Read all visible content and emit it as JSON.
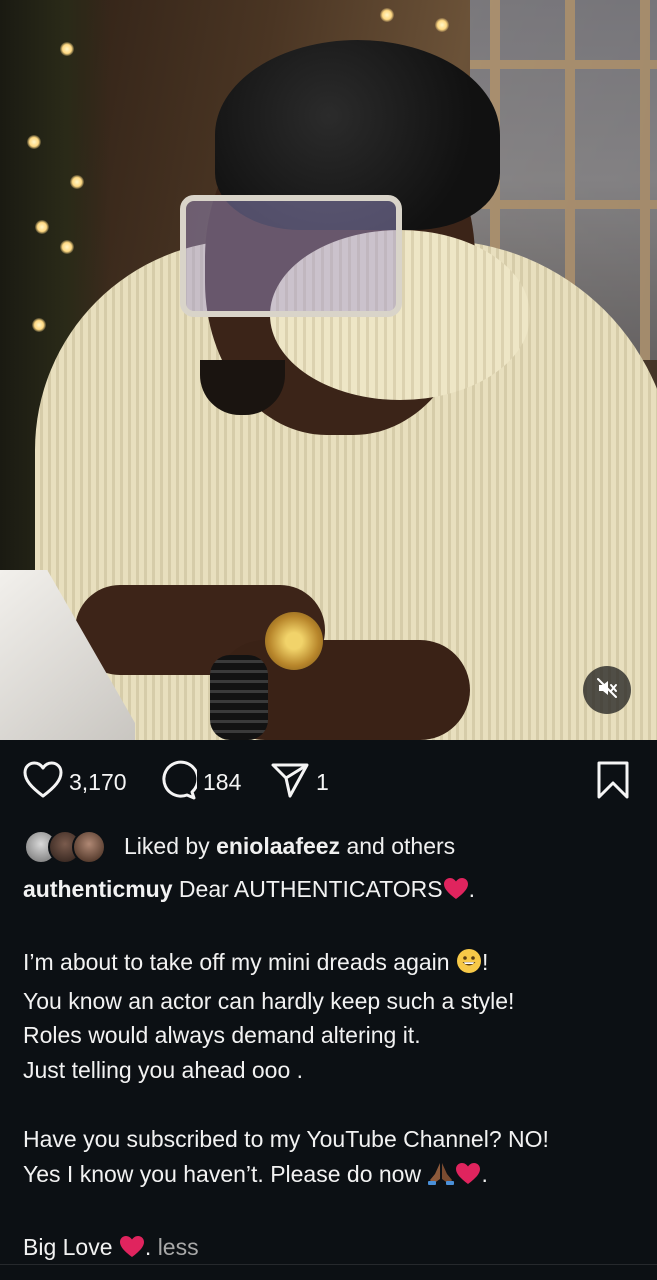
{
  "post": {
    "media": {
      "type": "video",
      "mute_icon": "speaker-muted-icon"
    },
    "actions": {
      "like_icon": "heart-icon",
      "like_count": "3,170",
      "comment_icon": "comment-bubble-icon",
      "comment_count": "184",
      "share_icon": "paper-plane-icon",
      "share_count": "1",
      "save_icon": "bookmark-icon"
    },
    "likes": {
      "prefix": "Liked by ",
      "user": "eniolaafeez",
      "suffix": " and others"
    },
    "caption": {
      "username": "authenticmuy",
      "line1_text": " Dear AUTHENTICATORS",
      "line1_tail": ".",
      "line2": "",
      "line3_text": "I’m about to take off my mini dreads again ",
      "line3_tail": "!",
      "line4": "You know an actor can hardly keep such a style!",
      "line5": "Roles would always demand altering it.",
      "line6": "Just telling you ahead ooo .",
      "line7": "",
      "line8": "Have you subscribed to my YouTube Channel? NO!",
      "line9_text": "Yes I know you haven’t. Please do now ",
      "line9_tail": ".",
      "line10": "",
      "line11_text": "Big Love ",
      "line11_tail": ". ",
      "less_label": "less"
    }
  },
  "colors": {
    "background": "#0c1014",
    "text": "#f5f5f5",
    "muted": "#a8a8a8",
    "heart_red": "#e0245e"
  }
}
